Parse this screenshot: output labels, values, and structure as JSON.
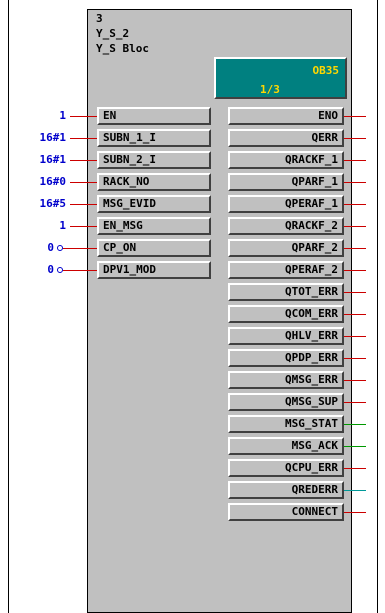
{
  "block": {
    "number": "3",
    "name": "Y_S_2",
    "type": "Y_S Bloc",
    "ob_name": "OB35",
    "ob_sequence": "1/3"
  },
  "inputs": [
    {
      "name": "EN",
      "value": "1",
      "negated": false
    },
    {
      "name": "SUBN_1_I",
      "value": "16#1",
      "negated": false
    },
    {
      "name": "SUBN_2_I",
      "value": "16#1",
      "negated": false
    },
    {
      "name": "RACK_NO",
      "value": "16#0",
      "negated": false
    },
    {
      "name": "MSG_EVID",
      "value": "16#5",
      "negated": false
    },
    {
      "name": "EN_MSG",
      "value": "1",
      "negated": false
    },
    {
      "name": "CP_ON",
      "value": "0",
      "negated": true
    },
    {
      "name": "DPV1_MOD",
      "value": "0",
      "negated": true
    }
  ],
  "outputs": [
    {
      "name": "ENO",
      "wire": "#cc0000"
    },
    {
      "name": "QERR",
      "wire": "#cc0000"
    },
    {
      "name": "QRACKF_1",
      "wire": "#cc0000"
    },
    {
      "name": "QPARF_1",
      "wire": "#cc0000"
    },
    {
      "name": "QPERAF_1",
      "wire": "#cc0000"
    },
    {
      "name": "QRACKF_2",
      "wire": "#cc0000"
    },
    {
      "name": "QPARF_2",
      "wire": "#cc0000"
    },
    {
      "name": "QPERAF_2",
      "wire": "#cc0000"
    },
    {
      "name": "QTOT_ERR",
      "wire": "#cc0000"
    },
    {
      "name": "QCOM_ERR",
      "wire": "#cc0000"
    },
    {
      "name": "QHLV_ERR",
      "wire": "#cc0000"
    },
    {
      "name": "QPDP_ERR",
      "wire": "#cc0000"
    },
    {
      "name": "QMSG_ERR",
      "wire": "#cc0000"
    },
    {
      "name": "QMSG_SUP",
      "wire": "#cc0000"
    },
    {
      "name": "MSG_STAT",
      "wire": "#009900"
    },
    {
      "name": "MSG_ACK",
      "wire": "#009900"
    },
    {
      "name": "QCPU_ERR",
      "wire": "#cc0000"
    },
    {
      "name": "QREDERR",
      "wire": "#009999"
    },
    {
      "name": "CONNECT",
      "wire": "#cc0000"
    }
  ],
  "colors": {
    "block_bg": "#c0c0c0",
    "ob_bg": "#008080",
    "ob_text": "#ffd700",
    "input_value": "#0000cc",
    "input_wire": "#cc0000"
  }
}
